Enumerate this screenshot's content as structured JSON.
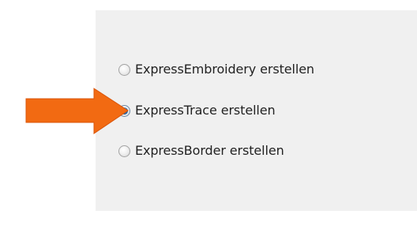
{
  "options": [
    {
      "label": "ExpressEmbroidery erstellen",
      "checked": false
    },
    {
      "label": "ExpressTrace erstellen",
      "checked": true
    },
    {
      "label": "ExpressBorder erstellen",
      "checked": false
    }
  ],
  "selected_index": 1,
  "colors": {
    "panel_bg": "#f0f0f0",
    "arrow": "#f26a12",
    "text": "#222222",
    "radio_selected": "#2e7fc7"
  },
  "icons": {
    "annotation_arrow": "arrow-right-icon"
  }
}
